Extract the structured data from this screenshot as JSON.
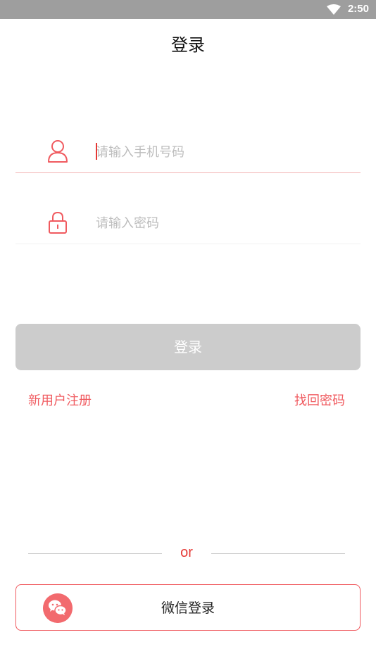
{
  "status_bar": {
    "time": "2:50",
    "wifi_icon": "wifi-icon"
  },
  "header": {
    "title": "登录"
  },
  "form": {
    "phone": {
      "placeholder": "请输入手机号码",
      "value": "",
      "icon": "user-icon"
    },
    "password": {
      "placeholder": "请输入密码",
      "value": "",
      "icon": "lock-icon"
    },
    "login_label": "登录"
  },
  "links": {
    "register": "新用户注册",
    "recover": "找回密码"
  },
  "divider": {
    "label": "or"
  },
  "wechat": {
    "label": "微信登录",
    "icon": "wechat-icon"
  },
  "colors": {
    "accent": "#f05a5f",
    "status_bar": "#9e9e9e",
    "button_disabled": "#cccccc",
    "placeholder": "#bdbdbd"
  }
}
